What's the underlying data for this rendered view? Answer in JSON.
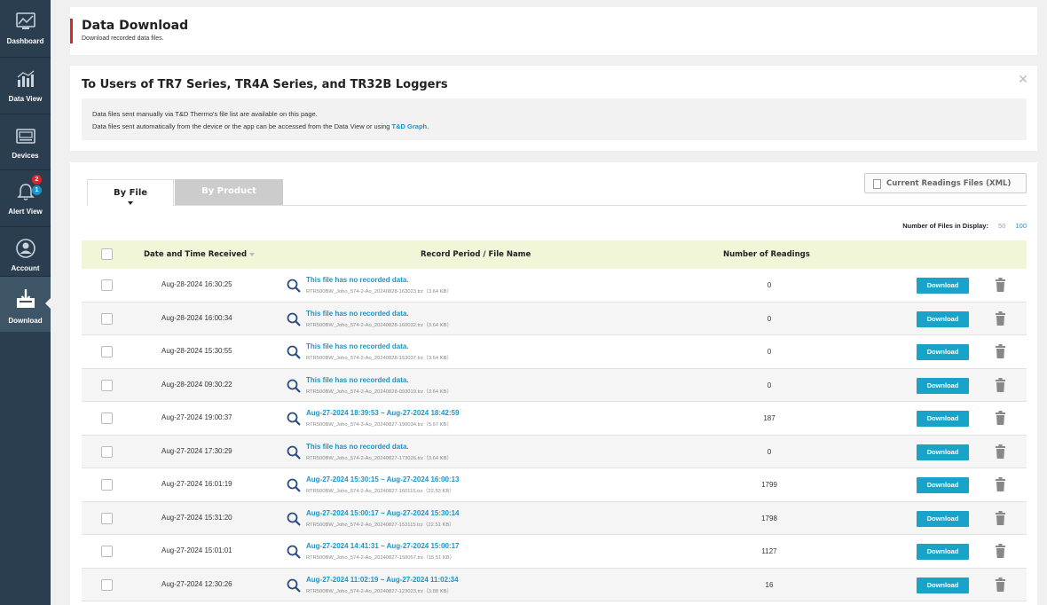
{
  "sidebar": {
    "items": [
      {
        "label": "Dashboard",
        "icon": "dashboard-icon"
      },
      {
        "label": "Data View",
        "icon": "chart-icon"
      },
      {
        "label": "Devices",
        "icon": "device-icon"
      },
      {
        "label": "Alert View",
        "icon": "alert-bell-icon",
        "badge_red": "2",
        "badge_blue": "1"
      },
      {
        "label": "Account",
        "icon": "account-icon"
      },
      {
        "label": "Download",
        "icon": "download-icon",
        "active": true
      }
    ]
  },
  "header": {
    "title": "Data Download",
    "subtitle": "Download recorded data files."
  },
  "notice": {
    "title": "To Users of TR7 Series, TR4A Series, and TR32B Loggers",
    "line1": "Data files sent manually via T&D Thermo's file list are available on this page.",
    "line2_prefix": "Data files sent automatically from the device or the app can be accessed from the Data View or using ",
    "line2_link": "T&D Graph",
    "line2_suffix": "."
  },
  "tabs": {
    "by_file": "By File",
    "by_product": "By Product"
  },
  "xml_button": "Current Readings Files (XML)",
  "display_count": {
    "label": "Number of Files in Display:",
    "opt50": "50",
    "opt100": "100"
  },
  "table": {
    "headers": {
      "date": "Date and Time Received",
      "period": "Record Period / File Name",
      "readings": "Number of Readings"
    },
    "download_label": "Download",
    "rows": [
      {
        "date": "Aug-28-2024 16:30:25",
        "title": "This file has no recorded data.",
        "file": "RTR500BW_Joho_574-2-Ao_20240828-163023.trz（3.64 KB）",
        "readings": "0"
      },
      {
        "date": "Aug-28-2024 16:00:34",
        "title": "This file has no recorded data.",
        "file": "RTR500BW_Joho_574-2-Ao_20240828-160032.trz（3.64 KB）",
        "readings": "0"
      },
      {
        "date": "Aug-28-2024 15:30:55",
        "title": "This file has no recorded data.",
        "file": "RTR500BW_Joho_574-2-Ao_20240828-153037.trz（3.64 KB）",
        "readings": "0"
      },
      {
        "date": "Aug-28-2024 09:30:22",
        "title": "This file has no recorded data.",
        "file": "RTR500BW_Joho_574-2-Ao_20240828-093019.trz（3.64 KB）",
        "readings": "0"
      },
      {
        "date": "Aug-27-2024 19:00:37",
        "title": "Aug-27-2024 18:39:53 ~ Aug-27-2024 18:42:59",
        "file": "RTR500BW_Joho_574-3-Ao_20240827-190034.trz（5.67 KB）",
        "readings": "187"
      },
      {
        "date": "Aug-27-2024 17:30:29",
        "title": "This file has no recorded data.",
        "file": "RTR500BW_Joho_574-2-Ao_20240827-173026.trz（3.64 KB）",
        "readings": "0"
      },
      {
        "date": "Aug-27-2024 16:01:19",
        "title": "Aug-27-2024 15:30:15 ~ Aug-27-2024 16:00:13",
        "file": "RTR500BW_Joho_574-2-Ao_20240827-160115.trz（22.53 KB）",
        "readings": "1799"
      },
      {
        "date": "Aug-27-2024 15:31:20",
        "title": "Aug-27-2024 15:00:17 ~ Aug-27-2024 15:30:14",
        "file": "RTR500BW_Joho_574-2-Ao_20240827-153115.trz（22.51 KB）",
        "readings": "1798"
      },
      {
        "date": "Aug-27-2024 15:01:01",
        "title": "Aug-27-2024 14:41:31 ~ Aug-27-2024 15:00:17",
        "file": "RTR500BW_Joho_574-2-Ao_20240827-150057.trz（15.51 KB）",
        "readings": "1127"
      },
      {
        "date": "Aug-27-2024 12:30:26",
        "title": "Aug-27-2024 11:02:19 ~ Aug-27-2024 11:02:34",
        "file": "RTR500BW_Joho_574-2-Ao_20240827-123023.trz（3.88 KB）",
        "readings": "16"
      }
    ]
  },
  "colors": {
    "sidebar_bg": "#2b3e50",
    "accent_red": "#d9262c",
    "link_blue": "#1a95c8",
    "button_blue": "#1aa3c8",
    "header_row_bg": "#f2f6d8"
  }
}
